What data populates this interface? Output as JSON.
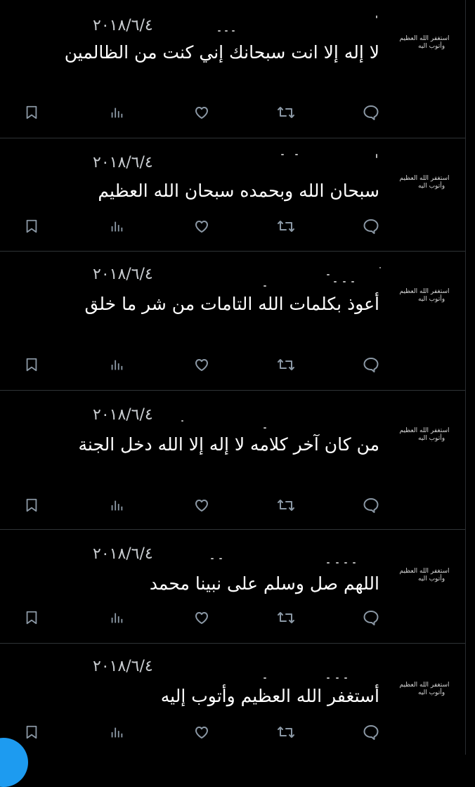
{
  "tweets": [
    {
      "avatar_line1": "استغفر الله العظيم",
      "avatar_line2": "وأتوب اليه",
      "date": "٢٠١٨/٦/٤",
      "text": "لا إله إلا انت سبحانك إني كنت من الظالمين"
    },
    {
      "avatar_line1": "استغفر الله العظيم",
      "avatar_line2": "وأتوب اليه",
      "date": "٢٠١٨/٦/٤",
      "text": "سبحان الله وبحمده سبحان الله العظيم"
    },
    {
      "avatar_line1": "استغفر الله العظيم",
      "avatar_line2": "وأتوب اليه",
      "date": "٢٠١٨/٦/٤",
      "text": "أعوذ بكلمات الله التامات من شر ما خلق"
    },
    {
      "avatar_line1": "استغفر الله العظيم",
      "avatar_line2": "وأتوب اليه",
      "date": "٢٠١٨/٦/٤",
      "text": "من كان آخر كلامه لا إله إلا الله دخل الجنة"
    },
    {
      "avatar_line1": "استغفر الله العظيم",
      "avatar_line2": "وأتوب اليه",
      "date": "٢٠١٨/٦/٤",
      "text": "اللهم صل وسلم على نبينا محمد"
    },
    {
      "avatar_line1": "استغفر الله العظيم",
      "avatar_line2": "وأتوب اليه",
      "date": "٢٠١٨/٦/٤",
      "text": "أستغفر الله العظيم وأتوب إليه"
    }
  ],
  "icons": {
    "bookmark": "bookmark-icon",
    "views": "views-icon",
    "like": "heart-icon",
    "retweet": "retweet-icon",
    "reply": "reply-icon"
  },
  "colors": {
    "background": "#000000",
    "text": "#ffffff",
    "icon": "#8b98a5",
    "divider": "#2f3336",
    "accent": "#1d9bf0"
  }
}
